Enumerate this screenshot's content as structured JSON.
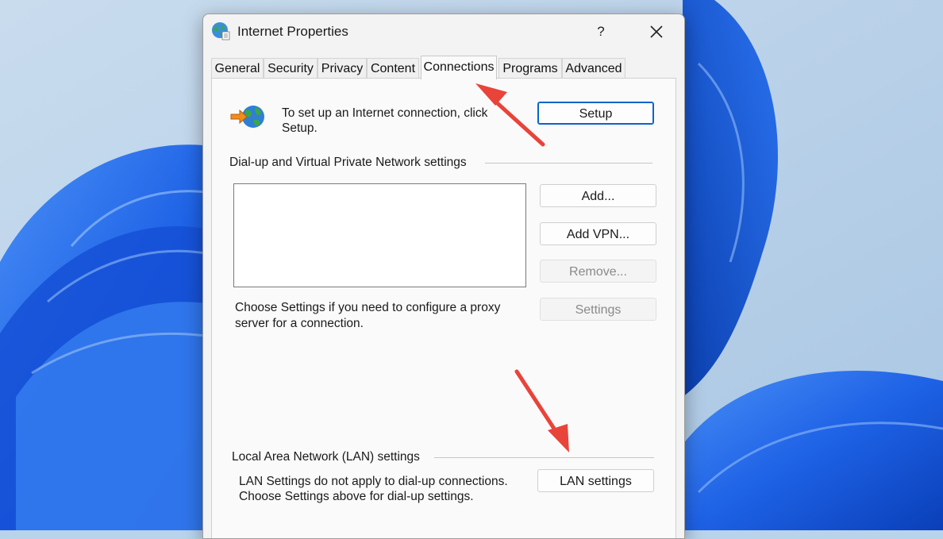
{
  "window": {
    "title": "Internet Properties",
    "help": "?"
  },
  "tabs": [
    {
      "label": "General"
    },
    {
      "label": "Security"
    },
    {
      "label": "Privacy"
    },
    {
      "label": "Content"
    },
    {
      "label": "Connections",
      "active": true
    },
    {
      "label": "Programs"
    },
    {
      "label": "Advanced"
    }
  ],
  "connections": {
    "setup_text_line1": "To set up an Internet connection, click",
    "setup_text_line2": "Setup.",
    "setup_button": "Setup",
    "vpn_section_title": "Dial-up and Virtual Private Network settings",
    "add_button": "Add...",
    "add_vpn_button": "Add VPN...",
    "remove_button": "Remove...",
    "settings_button": "Settings",
    "proxy_text_line1": "Choose Settings if you need to configure a proxy",
    "proxy_text_line2": "server for a connection.",
    "lan_section_title": "Local Area Network (LAN) settings",
    "lan_text_line1": "LAN Settings do not apply to dial-up connections.",
    "lan_text_line2": "Choose Settings above for dial-up settings.",
    "lan_button": "LAN settings"
  },
  "colors": {
    "annotation_arrow": "#e8443a",
    "primary_button_border": "#0a64c8",
    "wallpaper_blue": "#1b5fe0"
  },
  "icons": {
    "app": "globe-icon",
    "setup": "connection-wizard-icon",
    "close": "close-icon"
  }
}
